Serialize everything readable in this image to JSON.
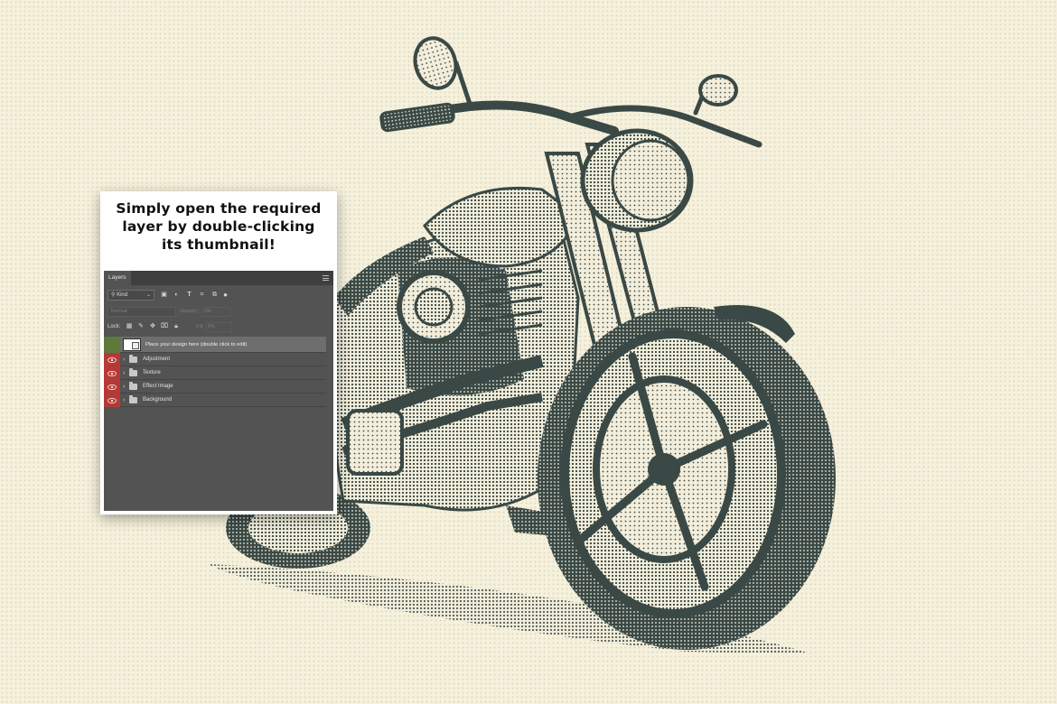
{
  "caption": "Simply open the required\nlayer by double-clicking\nits thumbnail!",
  "panel": {
    "tab_label": "Layers",
    "filter_kind": "Kind",
    "filter_chevron": "⌄",
    "blend_mode": "Normal",
    "opacity_label": "Opacity:",
    "opacity_value": "0%",
    "lock_label": "Lock:",
    "fill_label": "Fill:",
    "fill_value": "0%"
  },
  "layers": [
    {
      "name": "Place your design here (double click to edit)",
      "type": "smart-object",
      "eye_color": "#5e7a3a"
    },
    {
      "name": "Adjustment",
      "type": "group",
      "eye_color": "#b53a35"
    },
    {
      "name": "Texture",
      "type": "group",
      "eye_color": "#b53a35"
    },
    {
      "name": "Effect Image",
      "type": "group",
      "eye_color": "#b53a35"
    },
    {
      "name": "Background",
      "type": "group",
      "eye_color": "#b53a35"
    }
  ],
  "colors": {
    "background": "#f6f1dc",
    "ink": "#3a4946",
    "panel": "#535353",
    "eye_red": "#b53a35",
    "eye_green": "#5e7a3a"
  }
}
